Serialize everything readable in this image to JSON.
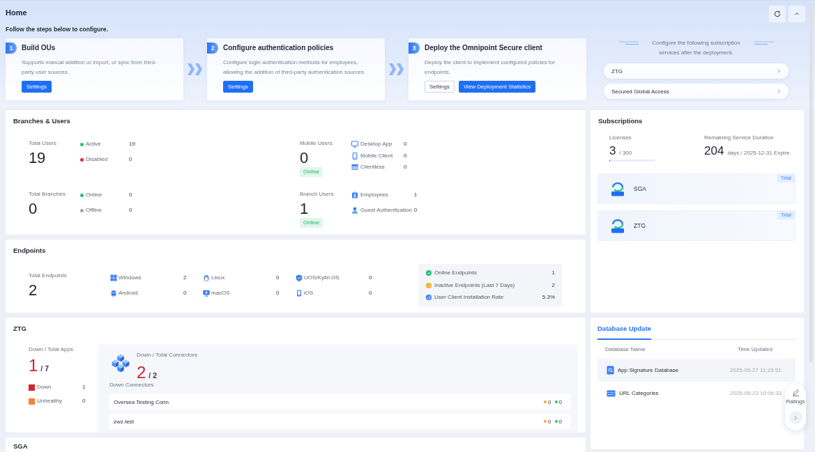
{
  "header": {
    "title": "Home",
    "intro": "Follow the steps below to configure."
  },
  "steps": [
    {
      "number": "1",
      "title": "Build OUs",
      "description": "Supports manual addition or import, or sync from third-party user sources.",
      "buttons": [
        {
          "label": "Settings",
          "kind": "primary"
        }
      ]
    },
    {
      "number": "2",
      "title": "Configure authentication policies",
      "description": "Configure login authentication methods for employees, allowing the addition of third-party authentication sources.",
      "buttons": [
        {
          "label": "Settings",
          "kind": "primary"
        }
      ]
    },
    {
      "number": "3",
      "title": "Deploy the Omnipoint Secure client",
      "description": "Deploy the client to implement configured policies for endpoints.",
      "buttons": [
        {
          "label": "Settings",
          "kind": "default"
        },
        {
          "label": "View Deployment Statistics",
          "kind": "primary"
        }
      ]
    }
  ],
  "subscription_guide": {
    "text": "Configure the following subscription services after the deployment.",
    "links": [
      "ZTG",
      "Secured Global Access"
    ]
  },
  "branches_users": {
    "title": "Branches & Users",
    "groups": [
      {
        "label": "Total Users",
        "value": "19",
        "items": [
          {
            "label": "Active",
            "value": "19",
            "color": "#1fc27a"
          },
          {
            "label": "Disabled",
            "value": "0",
            "color": "#f0282d"
          }
        ]
      },
      {
        "label": "Mobile Users",
        "value": "0",
        "status": "Online",
        "items": [
          {
            "label": "Desktop App",
            "value": "0"
          },
          {
            "label": "Mobile Client",
            "value": "0"
          },
          {
            "label": "Clientless",
            "value": "0"
          }
        ]
      },
      {
        "label": "Total Branches",
        "value": "0",
        "items": [
          {
            "label": "Online",
            "value": "0",
            "color": "#1fc27a"
          },
          {
            "label": "Offline",
            "value": "0",
            "color": "#a3a8b2"
          }
        ]
      },
      {
        "label": "Branch Users",
        "value": "1",
        "status": "Online",
        "items": [
          {
            "label": "Employees",
            "value": "1"
          },
          {
            "label": "Guest Authentication",
            "value": "0"
          }
        ]
      }
    ]
  },
  "endpoints": {
    "title": "Endpoints",
    "total_label": "Total Endpoints",
    "total": "2",
    "platforms": [
      {
        "label": "Windows",
        "value": "2"
      },
      {
        "label": "Linux",
        "value": "0"
      },
      {
        "label": "UOS/Kylin OS",
        "value": "0"
      },
      {
        "label": "Android",
        "value": "0"
      },
      {
        "label": "macOS",
        "value": "0"
      },
      {
        "label": "iOS",
        "value": "0"
      }
    ],
    "stats": [
      {
        "label": "Online Endpoints",
        "value": "1",
        "color": "#22c07a"
      },
      {
        "label": "Inactive Endpoints (Last 7 Days)",
        "value": "2",
        "color": "#f5b12c"
      },
      {
        "label": "User Client Installation Rate",
        "value": "5.3%",
        "color": "#3b7cf4"
      }
    ]
  },
  "ztg": {
    "title": "ZTG",
    "apps": {
      "label": "Down / Total Apps",
      "down": "1",
      "total": "/ 7",
      "legend": [
        {
          "label": "Down",
          "value": "1",
          "color": "#d7232c"
        },
        {
          "label": "Unhealthy",
          "value": "0",
          "color": "#f6842e"
        }
      ]
    },
    "connectors": {
      "label": "Down / Total Connectors",
      "down": "2",
      "total": "/ 2",
      "list_title": "Down Connectors",
      "rows": [
        {
          "name": "Oversea Testing Conn",
          "counts": [
            {
              "value": "0",
              "color": "#f5a623"
            },
            {
              "value": "0",
              "color": "#22c07a"
            }
          ]
        },
        {
          "name": "zwz-test",
          "counts": [
            {
              "value": "0",
              "color": "#f5a623"
            },
            {
              "value": "0",
              "color": "#22c07a"
            }
          ]
        }
      ]
    }
  },
  "sga": {
    "title": "SGA"
  },
  "subscriptions": {
    "title": "Subscriptions",
    "licenses": {
      "label": "Licenses",
      "used": "3",
      "total": "/ 300",
      "level": 0.01
    },
    "duration": {
      "label": "Remaining Service Duration",
      "value": "204",
      "detail": "days / 2025-12-31 Expire"
    },
    "services": [
      {
        "name": "SGA",
        "badge": "Trial"
      },
      {
        "name": "ZTG",
        "badge": "Trial"
      }
    ]
  },
  "database_update": {
    "tabs": [
      {
        "label": "Database Update",
        "selected": true
      }
    ],
    "columns": [
      "Database Name",
      "Time Updated"
    ],
    "rows": [
      {
        "name": "App Signature Database",
        "time": "2025-05-27 11:15:51",
        "selected": true
      },
      {
        "name": "URL Categories",
        "time": "2025-05-23 10:06:33",
        "selected": false
      }
    ]
  },
  "ratings": {
    "label": "Ratings"
  }
}
